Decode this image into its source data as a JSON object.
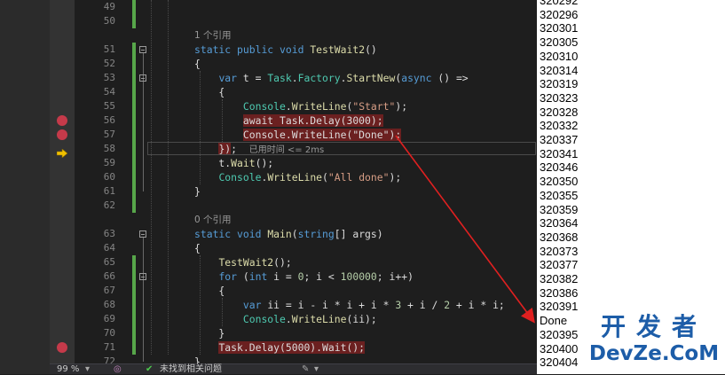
{
  "editor": {
    "lines": [
      {
        "n": "49",
        "segs": []
      },
      {
        "n": "50",
        "segs": []
      },
      {
        "lens": "1 个引用"
      },
      {
        "n": "51",
        "segs": [
          {
            "t": "static ",
            "c": "kw"
          },
          {
            "t": "public ",
            "c": "kw"
          },
          {
            "t": "void ",
            "c": "kw"
          },
          {
            "t": "TestWait2",
            "c": "fn"
          },
          {
            "t": "()"
          }
        ]
      },
      {
        "n": "52",
        "segs": [
          {
            "t": "{"
          }
        ]
      },
      {
        "n": "53",
        "segs": [
          {
            "t": "    "
          },
          {
            "t": "var ",
            "c": "kw"
          },
          {
            "t": "t = "
          },
          {
            "t": "Task",
            "c": "ty"
          },
          {
            "t": "."
          },
          {
            "t": "Factory",
            "c": "ty"
          },
          {
            "t": "."
          },
          {
            "t": "StartNew",
            "c": "fn"
          },
          {
            "t": "("
          },
          {
            "t": "async",
            "c": "kw"
          },
          {
            "t": " () =>"
          }
        ]
      },
      {
        "n": "54",
        "segs": [
          {
            "t": "    {"
          }
        ]
      },
      {
        "n": "55",
        "segs": [
          {
            "t": "        "
          },
          {
            "t": "Console",
            "c": "ty"
          },
          {
            "t": "."
          },
          {
            "t": "WriteLine",
            "c": "fn"
          },
          {
            "t": "("
          },
          {
            "t": "\"Start\"",
            "c": "str"
          },
          {
            "t": ");"
          }
        ]
      },
      {
        "n": "56",
        "segs": [
          {
            "t": "        "
          },
          {
            "t": "await Task.Delay(3000);",
            "c": "hl"
          }
        ]
      },
      {
        "n": "57",
        "segs": [
          {
            "t": "        "
          },
          {
            "t": "Console.WriteLine(\"Done\");",
            "c": "hl"
          }
        ]
      },
      {
        "n": "58",
        "segs": [
          {
            "t": "    "
          },
          {
            "t": "})",
            "c": "hl"
          },
          {
            "t": ";  "
          },
          {
            "t": "已用时间 <= 2ms",
            "c": "inline"
          }
        ]
      },
      {
        "n": "59",
        "segs": [
          {
            "t": "    t."
          },
          {
            "t": "Wait",
            "c": "fn"
          },
          {
            "t": "();"
          }
        ]
      },
      {
        "n": "60",
        "segs": [
          {
            "t": "    "
          },
          {
            "t": "Console",
            "c": "ty"
          },
          {
            "t": "."
          },
          {
            "t": "WriteLine",
            "c": "fn"
          },
          {
            "t": "("
          },
          {
            "t": "\"All done\"",
            "c": "str"
          },
          {
            "t": ");"
          }
        ]
      },
      {
        "n": "61",
        "segs": [
          {
            "t": "}"
          }
        ]
      },
      {
        "n": "62",
        "segs": []
      },
      {
        "lens": "0 个引用"
      },
      {
        "n": "63",
        "segs": [
          {
            "t": "static ",
            "c": "kw"
          },
          {
            "t": "void ",
            "c": "kw"
          },
          {
            "t": "Main",
            "c": "fn"
          },
          {
            "t": "("
          },
          {
            "t": "string",
            "c": "kw"
          },
          {
            "t": "[] args)"
          }
        ]
      },
      {
        "n": "64",
        "segs": [
          {
            "t": "{"
          }
        ]
      },
      {
        "n": "65",
        "segs": [
          {
            "t": "    "
          },
          {
            "t": "TestWait2",
            "c": "fn"
          },
          {
            "t": "();"
          }
        ]
      },
      {
        "n": "66",
        "segs": [
          {
            "t": "    "
          },
          {
            "t": "for ",
            "c": "kw"
          },
          {
            "t": "("
          },
          {
            "t": "int ",
            "c": "kw"
          },
          {
            "t": "i = "
          },
          {
            "t": "0",
            "c": "nm"
          },
          {
            "t": "; i < "
          },
          {
            "t": "100000",
            "c": "nm"
          },
          {
            "t": "; i++)"
          }
        ]
      },
      {
        "n": "67",
        "segs": [
          {
            "t": "    {"
          }
        ]
      },
      {
        "n": "68",
        "segs": [
          {
            "t": "        "
          },
          {
            "t": "var ",
            "c": "kw"
          },
          {
            "t": "ii = i - i * i + i * "
          },
          {
            "t": "3",
            "c": "nm"
          },
          {
            "t": " + i / "
          },
          {
            "t": "2",
            "c": "nm"
          },
          {
            "t": " + i * i;"
          }
        ]
      },
      {
        "n": "69",
        "segs": [
          {
            "t": "        "
          },
          {
            "t": "Console",
            "c": "ty"
          },
          {
            "t": "."
          },
          {
            "t": "WriteLine",
            "c": "fn"
          },
          {
            "t": "(ii);"
          }
        ]
      },
      {
        "n": "70",
        "segs": [
          {
            "t": "    }"
          }
        ]
      },
      {
        "n": "71",
        "segs": [
          {
            "t": "    "
          },
          {
            "t": "Task.Delay(5000).Wait();",
            "c": "hl"
          }
        ]
      },
      {
        "n": "72",
        "segs": [
          {
            "t": "}"
          }
        ]
      }
    ]
  },
  "output": {
    "lines": [
      "320292",
      "320296",
      "320301",
      "320305",
      "320310",
      "320314",
      "320319",
      "320323",
      "320328",
      "320332",
      "320337",
      "320341",
      "320346",
      "320350",
      "320355",
      "320359",
      "320364",
      "320368",
      "320373",
      "320377",
      "320382",
      "320386",
      "320391",
      "Done",
      "320395",
      "320400",
      "320404"
    ]
  },
  "statusbar": {
    "zoom": "99 %",
    "issues": "未找到相关问题"
  },
  "watermark": {
    "cn": "开发者",
    "en": "DevZe.CoM"
  },
  "colors": {
    "breakpoint": "#c53a4a",
    "highlight": "#6b2020",
    "annotation_arrow": "#e02020",
    "watermark": "#1d5da8"
  }
}
